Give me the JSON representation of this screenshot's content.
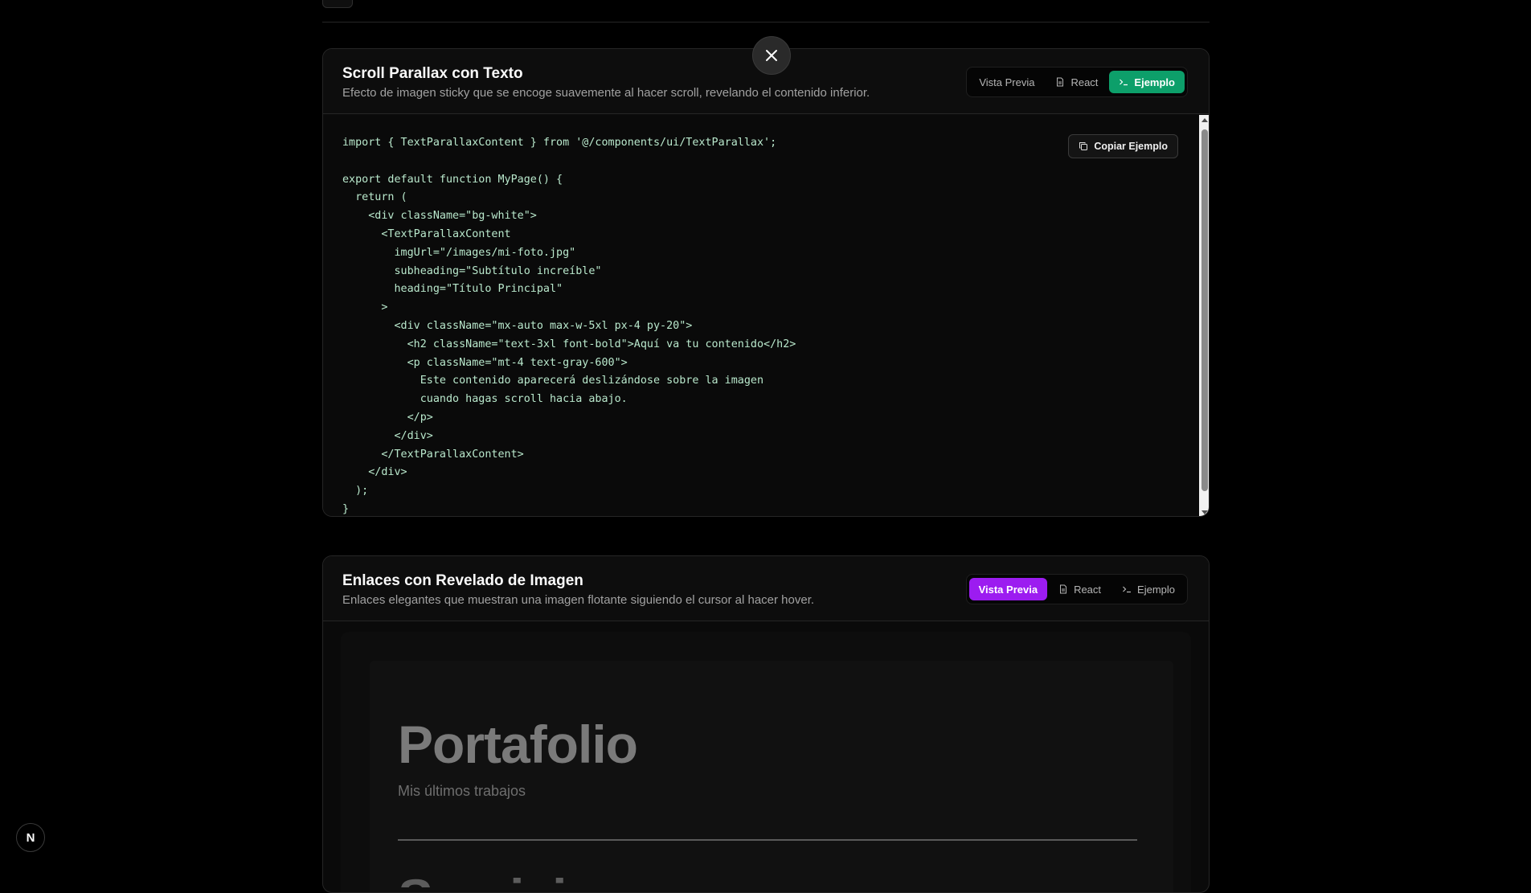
{
  "card1": {
    "title": "Scroll Parallax con Texto",
    "description": "Efecto de imagen sticky que se encoge suavemente al hacer scroll, revelando el contenido inferior.",
    "tabs": [
      {
        "label": "Vista Previa",
        "icon": null,
        "active": false
      },
      {
        "label": "React",
        "icon": "file-icon",
        "active": false
      },
      {
        "label": "Ejemplo",
        "icon": "terminal-icon",
        "active": true
      }
    ],
    "copy_label": "Copiar Ejemplo",
    "code": "import { TextParallaxContent } from '@/components/ui/TextParallax';\n\nexport default function MyPage() {\n  return (\n    <div className=\"bg-white\">\n      <TextParallaxContent\n        imgUrl=\"/images/mi-foto.jpg\"\n        subheading=\"Subtítulo increíble\"\n        heading=\"Título Principal\"\n      >\n        <div className=\"mx-auto max-w-5xl px-4 py-20\">\n          <h2 className=\"text-3xl font-bold\">Aquí va tu contenido</h2>\n          <p className=\"mt-4 text-gray-600\">\n            Este contenido aparecerá deslizándose sobre la imagen\n            cuando hagas scroll hacia abajo.\n          </p>\n        </div>\n      </TextParallaxContent>\n    </div>\n  );\n}",
    "active_color": "#0d9f6a"
  },
  "card2": {
    "title": "Enlaces con Revelado de Imagen",
    "description": "Enlaces elegantes que muestran una imagen flotante siguiendo el cursor al hacer hover.",
    "tabs": [
      {
        "label": "Vista Previa",
        "icon": null,
        "active": true
      },
      {
        "label": "React",
        "icon": "file-icon",
        "active": false
      },
      {
        "label": "Ejemplo",
        "icon": "terminal-icon",
        "active": false
      }
    ],
    "active_color": "#9c1cf0",
    "preview": {
      "title": "Portafolio",
      "subtitle": "Mis últimos trabajos",
      "next_item": "Servicios"
    }
  },
  "badge": {
    "letter": "N"
  }
}
